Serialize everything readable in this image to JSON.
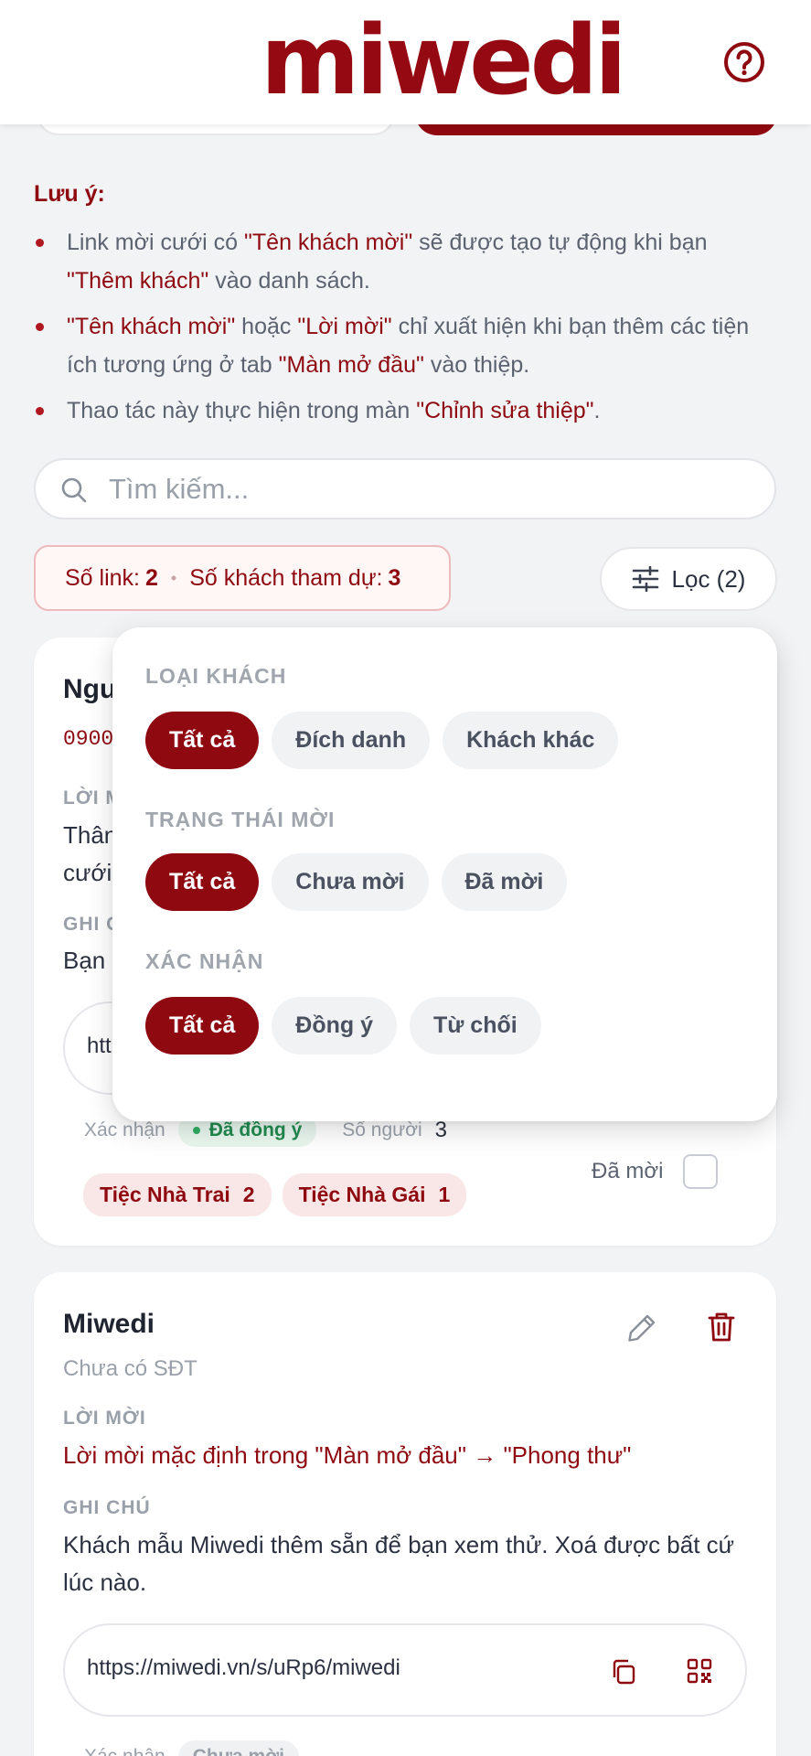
{
  "header": {
    "logo_text": "miwedi",
    "brand_color": "#950a12"
  },
  "notes": {
    "title": "Lưu ý:",
    "items": [
      [
        {
          "t": "Link mời cưới có ",
          "hl": false
        },
        {
          "t": "\"Tên khách mời\"",
          "hl": true
        },
        {
          "t": " sẽ được tạo tự động khi bạn ",
          "hl": false
        },
        {
          "t": "\"Thêm khách\"",
          "hl": true
        },
        {
          "t": " vào danh sách.",
          "hl": false
        }
      ],
      [
        {
          "t": "\"Tên khách mời\"",
          "hl": true
        },
        {
          "t": " hoặc ",
          "hl": false
        },
        {
          "t": "\"Lời mời\"",
          "hl": true
        },
        {
          "t": " chỉ xuất hiện khi bạn thêm các tiện ích tương ứng ở tab ",
          "hl": false
        },
        {
          "t": "\"Màn mở đầu\"",
          "hl": true
        },
        {
          "t": " vào thiệp.",
          "hl": false
        }
      ],
      [
        {
          "t": "Thao tác này thực hiện trong màn ",
          "hl": false
        },
        {
          "t": "\"Chỉnh sửa thiệp\"",
          "hl": true
        },
        {
          "t": ".",
          "hl": false
        }
      ]
    ]
  },
  "search": {
    "placeholder": "Tìm kiếm...",
    "value": ""
  },
  "stats": {
    "links_label": "Số link:",
    "links_value": "2",
    "guests_label": "Số khách tham dự:",
    "guests_value": "3"
  },
  "filter_button": {
    "label": "Lọc (2)"
  },
  "filter_popover": {
    "guest_type_label": "LOẠI KHÁCH",
    "guest_type_options": [
      "Tất cả",
      "Đích danh",
      "Khách khác"
    ],
    "invite_status_label": "TRẠNG THÁI MỜI",
    "invite_status_options": [
      "Tất cả",
      "Chưa mời",
      "Đã mời"
    ],
    "confirm_label": "XÁC NHẬN",
    "confirm_options": [
      "Tất cả",
      "Đồng ý",
      "Từ chối"
    ],
    "selected": "Tất cả"
  },
  "guest1": {
    "name_partial": "Ngu",
    "phone_partial": "0900",
    "invite_label_partial": "LỜI M",
    "invite_line1": "Thân",
    "invite_line2": "cưới",
    "note_label_partial": "GHI C",
    "note_partial": "Bạn",
    "link_partial": "htt",
    "confirm_label": "Xác nhận",
    "confirm_status": "Đã đồng ý",
    "people_label": "Số người",
    "people_count": "3",
    "tags": [
      {
        "name": "Tiệc Nhà Trai",
        "count": "2"
      },
      {
        "name": "Tiệc Nhà Gái",
        "count": "1"
      }
    ],
    "invited_label": "Đã mời",
    "invited": false
  },
  "guest2": {
    "name": "Miwedi",
    "phone": "Chưa có SĐT",
    "invite_label": "LỜI MỜI",
    "invite_text": "Lời mời mặc định trong \"Màn mở đầu\" → \"Phong thư\"",
    "note_label": "GHI CHÚ",
    "note_text": "Khách mẫu Miwedi thêm sẵn để bạn xem thử. Xoá được bất cứ lúc nào.",
    "link": "https://miwedi.vn/s/uRp6/miwedi",
    "confirm_label": "Xác nhận",
    "confirm_status": "Chưa mời"
  }
}
